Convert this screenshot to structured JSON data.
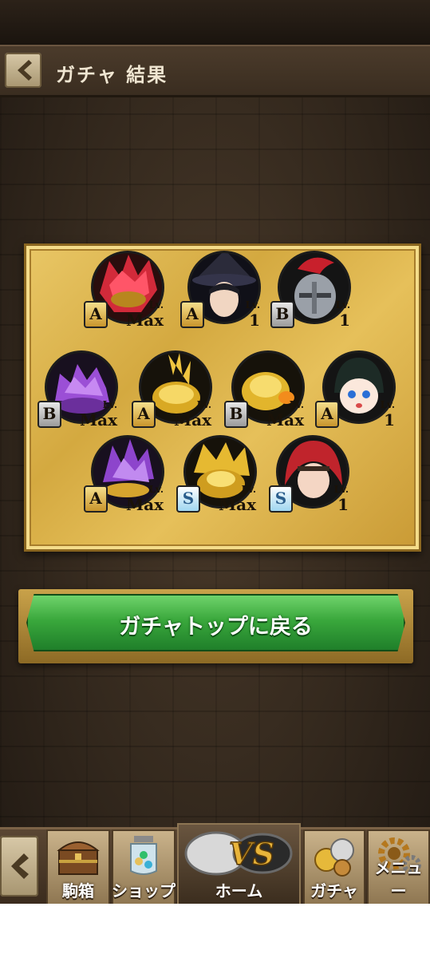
{
  "header": {
    "title": "ガチャ 結果"
  },
  "results": [
    {
      "rank": "A",
      "lv_tag": "Lv.",
      "level": "Max",
      "creature": "red-crystal-dragon"
    },
    {
      "rank": "A",
      "lv_tag": "Lv.",
      "level": "1",
      "creature": "witch-hat-boy"
    },
    {
      "rank": "B",
      "lv_tag": "Lv.",
      "level": "1",
      "creature": "armored-knight"
    },
    {
      "rank": "B",
      "lv_tag": "Lv.",
      "level": "Max",
      "creature": "purple-crystal-turtle"
    },
    {
      "rank": "A",
      "lv_tag": "Lv.",
      "level": "Max",
      "creature": "gold-spiked-turtle"
    },
    {
      "rank": "B",
      "lv_tag": "Lv.",
      "level": "Max",
      "creature": "gold-turtle"
    },
    {
      "rank": "A",
      "lv_tag": "Lv.",
      "level": "1",
      "creature": "chibi-girl"
    },
    {
      "rank": "A",
      "lv_tag": "Lv.",
      "level": "Max",
      "creature": "purple-crystal-dragon"
    },
    {
      "rank": "S",
      "lv_tag": "Lv.",
      "level": "Max",
      "creature": "gold-dragon"
    },
    {
      "rank": "S",
      "lv_tag": "Lv.",
      "level": "1",
      "creature": "red-hair-warrior"
    }
  ],
  "action": {
    "back_to_gacha_top": "ガチャトップに戻る"
  },
  "nav": {
    "items": [
      {
        "label": "駒箱",
        "icon": "treasure-chest-icon"
      },
      {
        "label": "ショップ",
        "icon": "coin-jar-icon"
      },
      {
        "label": "ホーム",
        "icon": "vs-emblem-icon"
      },
      {
        "label": "ガチャ",
        "icon": "coins-icon"
      },
      {
        "label": "メニュー",
        "icon": "gears-icon"
      }
    ]
  },
  "colors": {
    "board_gold": "#d4a940",
    "button_green": "#3aa83c",
    "frame_brown": "#3a2d20"
  }
}
